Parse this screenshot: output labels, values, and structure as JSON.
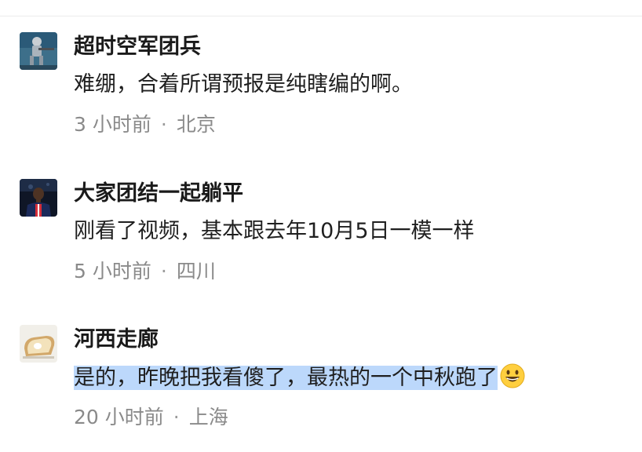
{
  "comments": [
    {
      "username": "超时空军团兵",
      "text": "难绷，合着所谓预报是纯瞎编的啊。",
      "time": "3 小时前",
      "separator": "·",
      "location": "北京",
      "avatar_icon": "soldier-avatar"
    },
    {
      "username": "大家团结一起躺平",
      "text": "刚看了视频，基本跟去年10月5日一模一样",
      "time": "5 小时前",
      "separator": "·",
      "location": "四川",
      "avatar_icon": "football-player-avatar"
    },
    {
      "username": "河西走廊",
      "text": "是的，昨晚把我看傻了，最热的一个中秋跑了",
      "time": "20 小时前",
      "separator": "·",
      "location": "上海",
      "avatar_icon": "bread-toast-avatar",
      "trailing_emoji": "grinning-face-emoji",
      "text_selected": true
    }
  ],
  "colors": {
    "username": "#1a1a1a",
    "body_text": "#1f1f1f",
    "meta_text": "#8a8a8a",
    "selection_highlight": "#bcd8fb",
    "divider": "#ececec"
  }
}
